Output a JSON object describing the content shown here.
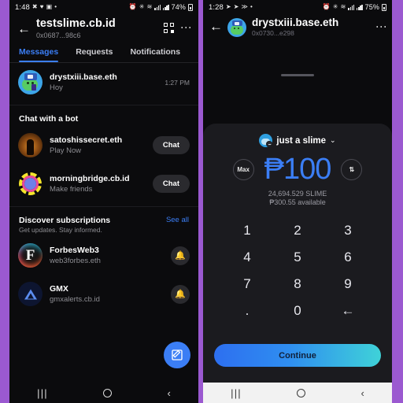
{
  "left_phone": {
    "status_bar": {
      "time": "1:48",
      "battery": "74%",
      "icons": [
        "x-icon",
        "heart-icon",
        "image-icon",
        "dot-icon",
        "alarm-icon",
        "bluetooth-icon",
        "wifi-icon"
      ]
    },
    "header": {
      "back_icon": "back-arrow-icon",
      "title": "testslime.cb.id",
      "address": "0x0687...98c6",
      "qr_icon": "qr-code-icon",
      "menu_icon": "kebab-menu-icon"
    },
    "tabs": [
      {
        "label": "Messages",
        "active": true
      },
      {
        "label": "Requests",
        "active": false
      },
      {
        "label": "Notifications",
        "active": false
      }
    ],
    "conversations": [
      {
        "avatar": "slime-avatar",
        "name": "drystxiii.base.eth",
        "preview": "Hoy",
        "time": "1:27 PM"
      }
    ],
    "bot_section": {
      "title": "Chat with a bot",
      "items": [
        {
          "avatar": "satoshi-avatar",
          "name": "satoshissecret.eth",
          "desc": "Play Now",
          "action": "Chat"
        },
        {
          "avatar": "morningbridge-avatar",
          "name": "morningbridge.cb.id",
          "desc": "Make friends",
          "action": "Chat"
        }
      ]
    },
    "discover_section": {
      "title": "Discover subscriptions",
      "subtitle": "Get updates. Stay informed.",
      "see_all": "See all",
      "items": [
        {
          "avatar": "forbes-avatar",
          "name": "ForbesWeb3",
          "desc": "web3forbes.eth",
          "action_icon": "bell-icon"
        },
        {
          "avatar": "gmx-avatar",
          "name": "GMX",
          "desc": "gmxalerts.cb.id",
          "action_icon": "bell-icon"
        }
      ]
    },
    "fab": {
      "icon": "compose-icon"
    },
    "nav": {
      "recent": "|||",
      "home": "home-circle-icon",
      "back": "back-chevron-icon"
    }
  },
  "right_phone": {
    "status_bar": {
      "time": "1:28",
      "battery": "75%",
      "icons": [
        "send-icon",
        "send-icon",
        "mute-icon",
        "dot-icon",
        "alarm-icon",
        "bluetooth-icon",
        "wifi-icon"
      ]
    },
    "header": {
      "back_icon": "back-arrow-icon",
      "avatar": "slime-avatar",
      "title": "drystxiii.base.eth",
      "address": "0x0730...e298",
      "menu_icon": "kebab-menu-icon"
    },
    "sheet": {
      "drag_handle": "drag-handle",
      "token": {
        "icon": "slime-token-icon",
        "name": "just a slime",
        "chevron": "⌄"
      },
      "max_label": "Max",
      "swap_icon": "swap-arrows-icon",
      "amount": "₱100",
      "balance_token": "24,694.529 SLIME",
      "balance_fiat": "₱300.55 available",
      "keypad": [
        "1",
        "2",
        "3",
        "4",
        "5",
        "6",
        "7",
        "8",
        "9",
        ".",
        "0",
        "←"
      ],
      "continue_label": "Continue"
    },
    "nav": {
      "recent": "|||",
      "home": "home-circle-icon",
      "back": "back-chevron-icon"
    }
  },
  "colors": {
    "accent_blue": "#3b7ef5",
    "sheet_bg": "#1b1b1f",
    "screen_bg": "#0b0b0d",
    "backdrop": "#9b59d0"
  }
}
